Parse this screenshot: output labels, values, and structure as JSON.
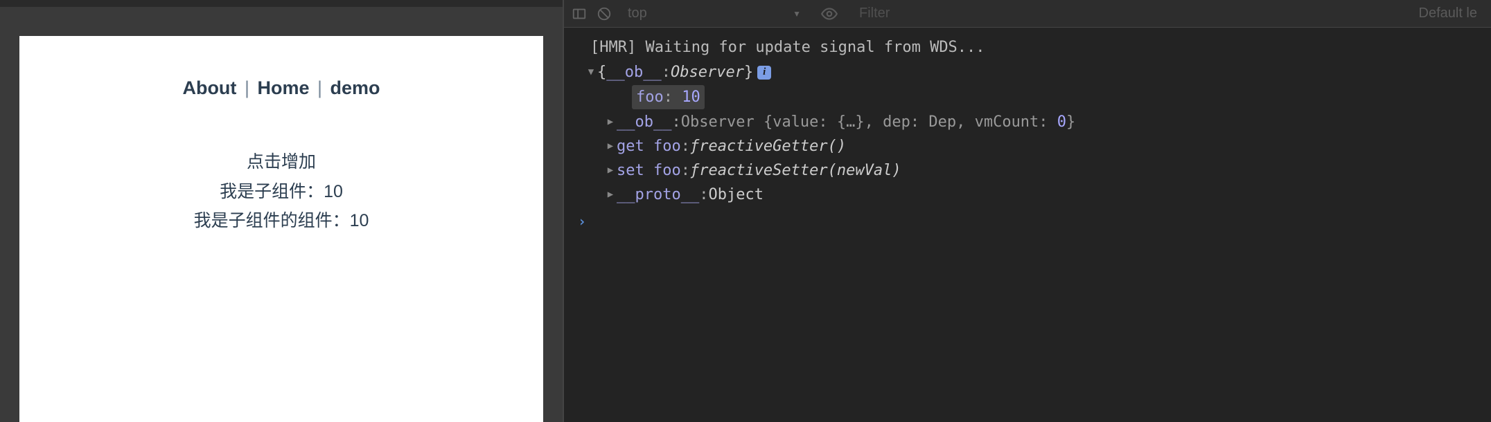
{
  "page": {
    "nav": {
      "about": "About",
      "home": "Home",
      "demo": "demo",
      "sep": "|"
    },
    "content": {
      "line1": "点击增加",
      "line2_prefix": "我是子组件：",
      "line2_value": "10",
      "line3_prefix": "我是子组件的组件：",
      "line3_value": "10"
    }
  },
  "devtools": {
    "toolbar": {
      "context": "top",
      "filter_placeholder": "Filter",
      "levels": "Default le"
    },
    "console": {
      "hmr": "[HMR] Waiting for update signal from WDS...",
      "root": {
        "open": "{",
        "key": "__ob__",
        "class": "Observer",
        "close": "}"
      },
      "foo": {
        "key": "foo",
        "value": "10"
      },
      "ob": {
        "key": "__ob__",
        "class": "Observer",
        "preview_open": " {value: {…}, dep: Dep, vmCount: ",
        "preview_num": "0",
        "preview_close": "}"
      },
      "getter": {
        "key": "get foo",
        "f": "ƒ",
        "name": " reactiveGetter()"
      },
      "setter": {
        "key": "set foo",
        "f": "ƒ",
        "name": " reactiveSetter(newVal)"
      },
      "proto": {
        "key": "__proto__",
        "type": "Object"
      }
    }
  }
}
